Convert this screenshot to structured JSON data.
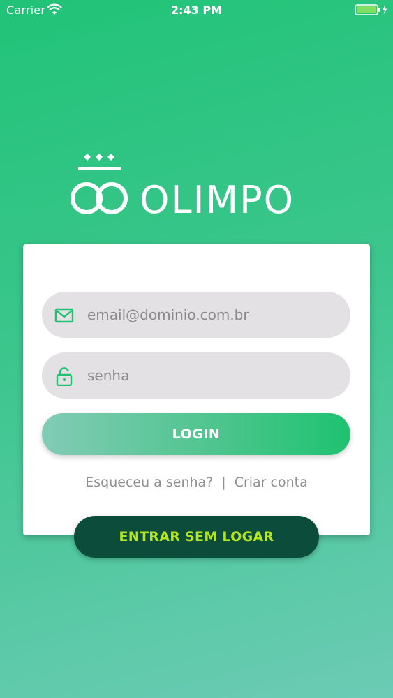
{
  "status_bar": {
    "carrier": "Carrier",
    "time": "2:43 PM",
    "wifi_icon": "wifi-icon",
    "battery_icon": "battery-charging-icon"
  },
  "logo": {
    "text": "OLIMPO",
    "emblem_icon": "rings-crown-emblem-icon"
  },
  "login_form": {
    "email": {
      "icon": "envelope-icon",
      "placeholder": "email@dominio.com.br",
      "value": ""
    },
    "password": {
      "icon": "lock-icon",
      "placeholder": "senha",
      "value": ""
    },
    "login_button": "LOGIN",
    "forgot_password_link": "Esqueceu a senha?",
    "separator": "|",
    "create_account_link": "Criar conta"
  },
  "guest_button": "ENTRAR SEM LOGAR",
  "colors": {
    "brand_green": "#21c378",
    "dark_green": "#0b4d3a",
    "lime_text": "#b5e61d",
    "field_bg": "#e3e1e3",
    "icon_green": "#1ec270"
  }
}
